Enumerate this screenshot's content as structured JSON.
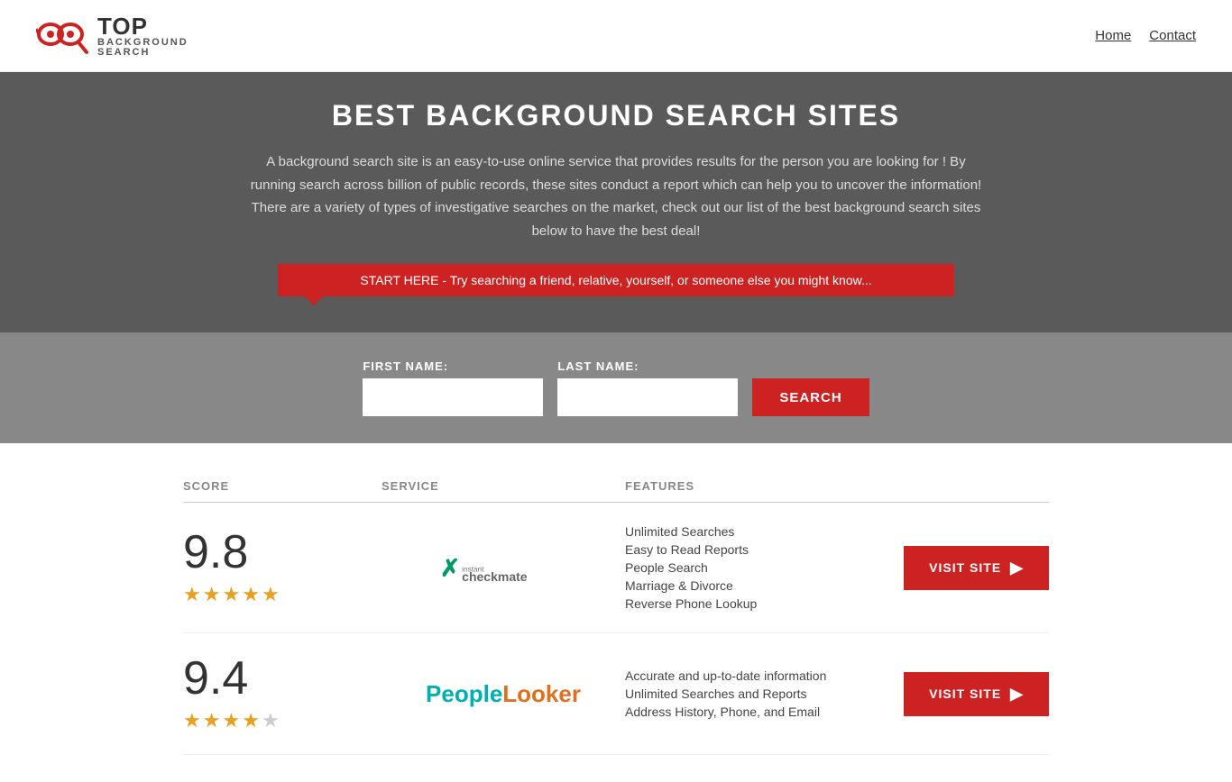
{
  "header": {
    "logo_top": "TOP",
    "logo_sub_line1": "BACKGROUND",
    "logo_sub_line2": "SEARCH",
    "nav": [
      {
        "label": "Home",
        "href": "#"
      },
      {
        "label": "Contact",
        "href": "#"
      }
    ]
  },
  "hero": {
    "title": "BEST BACKGROUND SEARCH SITES",
    "description": "A background search site is an easy-to-use online service that provides results  for the person you are looking for ! By  running  search across billion of public records, these sites conduct  a report which can help you to uncover the information! There are a variety of types of investigative searches on the market, check out our  list of the best background search sites below to have the best deal!",
    "banner_text": "START HERE - Try searching a friend, relative, yourself, or someone else you might know...",
    "first_name_label": "FIRST NAME:",
    "last_name_label": "LAST NAME:",
    "search_button": "SEARCH"
  },
  "table": {
    "headers": {
      "score": "SCORE",
      "service": "SERVICE",
      "features": "FEATURES"
    },
    "rows": [
      {
        "score": "9.8",
        "stars": 5,
        "service_name": "Instant Checkmate",
        "service_type": "checkmate",
        "features": [
          "Unlimited Searches",
          "Easy to Read Reports",
          "People Search",
          "Marriage & Divorce",
          "Reverse Phone Lookup"
        ],
        "visit_label": "VISIT SITE"
      },
      {
        "score": "9.4",
        "stars": 4,
        "service_name": "PeopleLooker",
        "service_type": "peoplelooker",
        "features": [
          "Accurate and up-to-date information",
          "Unlimited Searches and Reports",
          "Address History, Phone, and Email"
        ],
        "visit_label": "VISIT SITE"
      }
    ]
  }
}
